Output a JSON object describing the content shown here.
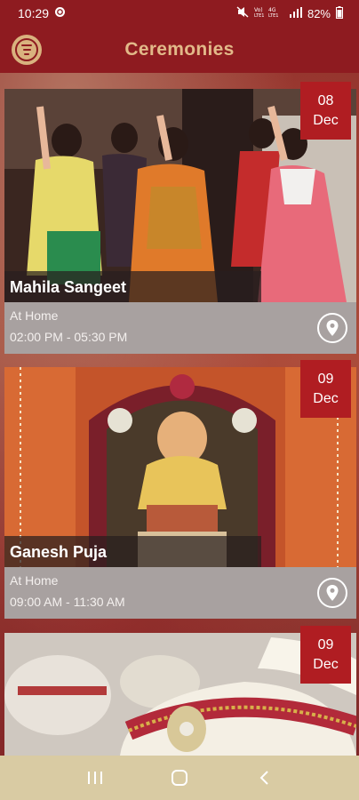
{
  "status_bar": {
    "time": "10:29",
    "battery": "82%",
    "network": "Vo) LTE1 4G LTE1"
  },
  "header": {
    "title": "Ceremonies",
    "menu_icon": "filter-menu-icon"
  },
  "ceremonies": [
    {
      "name": "Mahila Sangeet",
      "date_day": "08",
      "date_month": "Dec",
      "location": "At Home",
      "time": "02:00 PM - 05:30 PM",
      "photo": "women-dancing-photo"
    },
    {
      "name": "Ganesh Puja",
      "date_day": "09",
      "date_month": "Dec",
      "location": "At Home",
      "time": "09:00 AM - 11:30 AM",
      "photo": "ganesh-idol-photo"
    },
    {
      "name": "",
      "date_day": "09",
      "date_month": "Dec",
      "location": "",
      "time": "",
      "photo": "turban-safa-photo"
    }
  ],
  "colors": {
    "header_bg": "#8e1b20",
    "title_gold": "#e2b989",
    "date_badge": "#b01d22",
    "nav_bar": "#d9cba3",
    "info_panel": "#a8a1a0"
  },
  "nav": {
    "recents_icon": "recents-icon",
    "home_icon": "home-icon",
    "back_icon": "back-icon"
  }
}
